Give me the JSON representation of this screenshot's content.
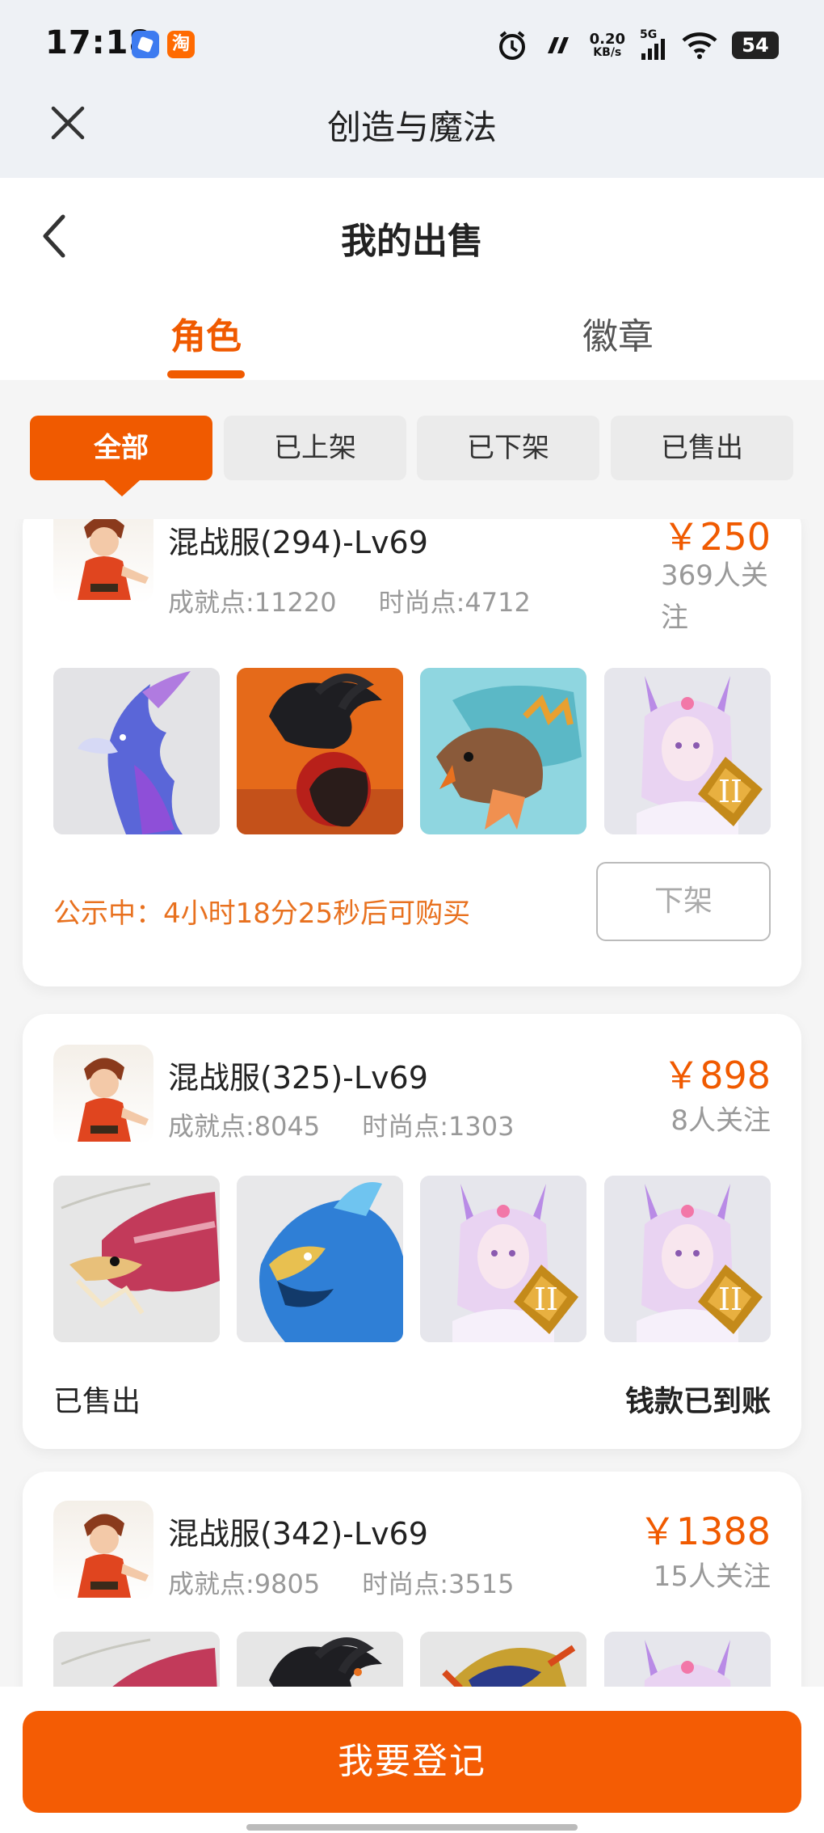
{
  "status_bar": {
    "time": "17:18",
    "app_icons": [
      "blue-app-icon",
      "taobao-icon"
    ],
    "taobao_glyph": "淘",
    "network_speed_value": "0.20",
    "network_speed_unit": "KB/s",
    "signal_type": "5G",
    "battery": "54"
  },
  "app_bar": {
    "title": "创造与魔法"
  },
  "page": {
    "title": "我的出售"
  },
  "tabs": [
    {
      "label": "角色",
      "active": true
    },
    {
      "label": "徽章",
      "active": false
    }
  ],
  "filters": [
    {
      "label": "全部",
      "active": true
    },
    {
      "label": "已上架",
      "active": false
    },
    {
      "label": "已下架",
      "active": false
    },
    {
      "label": "已售出",
      "active": false
    }
  ],
  "listings": [
    {
      "name": "混战服(294)-Lv69",
      "achievement": "成就点:11220",
      "fashion": "时尚点:4712",
      "price": "￥250",
      "followers": "369人关注",
      "pets": [
        "purple-phoenix",
        "black-ram-beast",
        "armored-lizard",
        "fox-fairy"
      ],
      "notice": "公示中：4小时18分25秒后可购买",
      "action": "下架"
    },
    {
      "name": "混战服(325)-Lv69",
      "achievement": "成就点:8045",
      "fashion": "时尚点:1303",
      "price": "￥898",
      "followers": "8人关注",
      "pets": [
        "red-dragon",
        "blue-phoenix",
        "fox-fairy",
        "fox-fairy"
      ],
      "status": "已售出",
      "payment": "钱款已到账"
    },
    {
      "name": "混战服(342)-Lv69",
      "achievement": "成就点:9805",
      "fashion": "时尚点:3515",
      "price": "￥1388",
      "followers": "15人关注",
      "pets": [
        "red-dragon",
        "black-ram-beast",
        "gold-dragon",
        "fox-fairy"
      ]
    }
  ],
  "bottom": {
    "button": "我要登记"
  },
  "colors": {
    "accent": "#f05a00",
    "notice": "#e8711f"
  }
}
